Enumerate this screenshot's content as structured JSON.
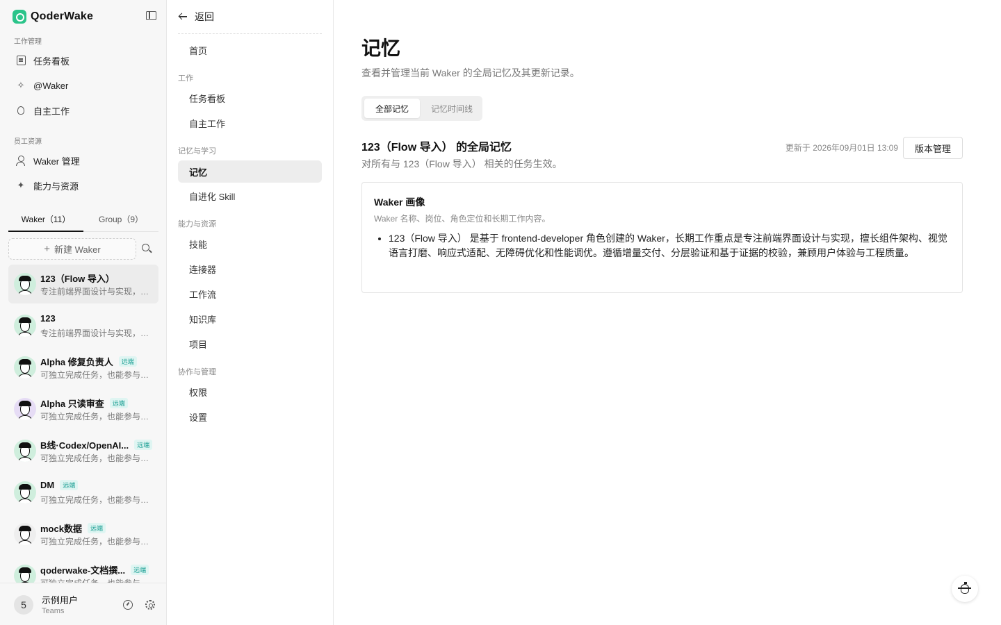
{
  "app": {
    "name": "QoderWake"
  },
  "sidebar": {
    "section_work": "工作管理",
    "work_items": [
      "任务看板",
      "@Waker",
      "自主工作"
    ],
    "section_staff": "员工资源",
    "staff_items": [
      "Waker 管理",
      "能力与资源"
    ],
    "tabs": [
      "Waker（11）",
      "Group（9）"
    ],
    "new_waker": "新建 Waker",
    "remote_badge": "远端",
    "agents": [
      {
        "name": "123（Flow 导入）",
        "desc": "专注前端界面设计与实现，擅长组件架构",
        "remote": false,
        "active": true
      },
      {
        "name": "123",
        "desc": "专注前端界面设计与实现，擅长组件架构",
        "remote": false,
        "active": false
      },
      {
        "name": "Alpha 修复负责人",
        "desc": "可独立完成任务，也能参与团队协作",
        "remote": true,
        "active": false
      },
      {
        "name": "Alpha 只读审查",
        "desc": "可独立完成任务，也能参与团队协作",
        "remote": true,
        "active": false
      },
      {
        "name": "B线·Codex/OpenAI...",
        "desc": "可独立完成任务，也能参与团队协作",
        "remote": true,
        "active": false
      },
      {
        "name": "DM",
        "desc": "可独立完成任务，也能参与团队协作",
        "remote": true,
        "active": false
      },
      {
        "name": "mock数据",
        "desc": "可独立完成任务，也能参与团队协作",
        "remote": true,
        "active": false
      },
      {
        "name": "qoderwake-文档撰...",
        "desc": "可独立完成任务，也能参与团队协作",
        "remote": true,
        "active": false
      }
    ],
    "user": {
      "avatar": "5",
      "name": "示例用户",
      "team": "Teams"
    }
  },
  "subnav": {
    "back": "返回",
    "home": "首页",
    "section_work": "工作",
    "work_items": [
      "任务看板",
      "自主工作"
    ],
    "section_memory": "记忆与学习",
    "memory_items": [
      "记忆",
      "自进化 Skill"
    ],
    "section_capability": "能力与资源",
    "capability_items": [
      "技能",
      "连接器",
      "工作流",
      "知识库",
      "项目"
    ],
    "section_collab": "协作与管理",
    "collab_items": [
      "权限",
      "设置"
    ]
  },
  "main": {
    "title": "记忆",
    "subtitle": "查看并管理当前 Waker 的全局记忆及其更新记录。",
    "segments": [
      "全部记忆",
      "记忆时间线"
    ],
    "memory_title": "123（Flow 导入） 的全局记忆",
    "memory_scope": "对所有与 123（Flow 导入） 相关的任务生效。",
    "updated": "更新于 2026年09月01日 13:09",
    "version_button": "版本管理",
    "card": {
      "title": "Waker 画像",
      "subtitle": "Waker 名称、岗位、角色定位和长期工作内容。",
      "items": [
        "123（Flow 导入） 是基于 frontend-developer 角色创建的 Waker，长期工作重点是专注前端界面设计与实现，擅长组件架构、视觉语言打磨、响应式适配、无障碍优化和性能调优。遵循增量交付、分层验证和基于证据的校验，兼顾用户体验与工程质量。"
      ]
    }
  },
  "colors": {
    "brand": "#2bc48a",
    "remote_badge_text": "#1a9e93",
    "remote_badge_bg": "#dff5f2"
  }
}
